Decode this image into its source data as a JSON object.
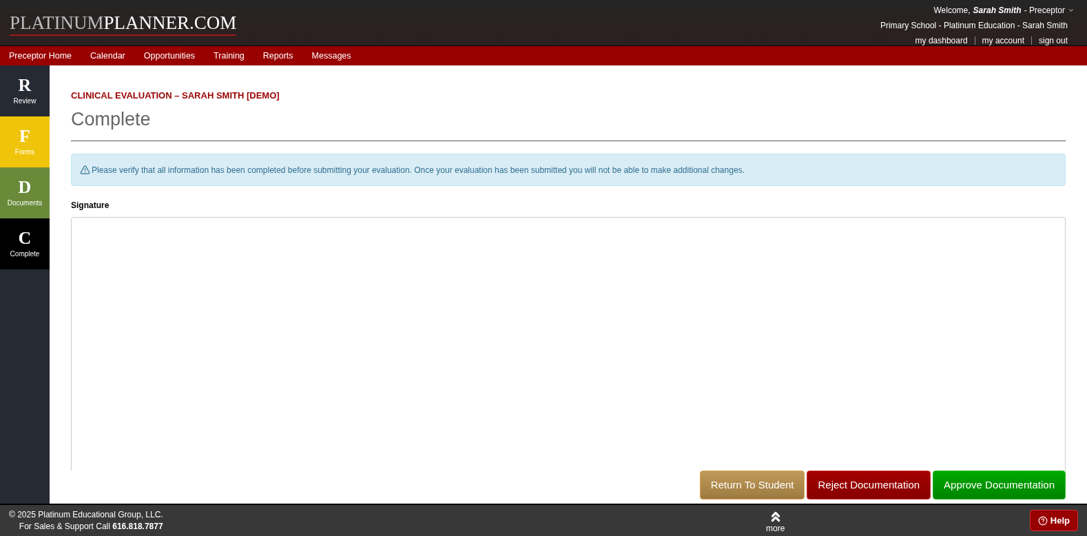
{
  "logo": {
    "part_1": "PLATINUM",
    "part_2": "PLANNER.COM"
  },
  "user_menu": {
    "greeting": "Welcome,",
    "user": "Sarah Smith",
    "role": "- Preceptor",
    "context": "Primary School - Platinum Education - Sarah Smith",
    "links": [
      "my dashboard",
      "my account",
      "sign out"
    ]
  },
  "nav": [
    "Preceptor Home",
    "Calendar",
    "Opportunities",
    "Training",
    "Reports",
    "Messages"
  ],
  "sidebar": {
    "items": [
      {
        "letter": "R",
        "label": "Review",
        "color": "#262a33"
      },
      {
        "letter": "F",
        "label": "Forms",
        "color": "#f0c40a"
      },
      {
        "letter": "D",
        "label": "Documents",
        "color": "#6a8a3a"
      },
      {
        "letter": "C",
        "label": "Complete",
        "color": "#000000"
      }
    ]
  },
  "page": {
    "eyebrow": "CLINICAL EVALUATION – SARAH SMITH [DEMO]",
    "title": "Complete",
    "alert": "Please verify that all information has been completed before submitting your evaluation. Once your evaluation has been submitted you will not be able to make additional changes.",
    "signature_label": "Signature"
  },
  "actions": [
    {
      "label": "Return To Student",
      "kind": "return"
    },
    {
      "label": "Reject Documentation",
      "kind": "reject"
    },
    {
      "label": "Approve Documentation",
      "kind": "approve"
    }
  ],
  "footer": {
    "copyright": "© 2025 Platinum Educational Group, LLC.",
    "support": "For Sales & Support Call",
    "phone": "616.818.7877",
    "more": "more",
    "help": "Help"
  }
}
